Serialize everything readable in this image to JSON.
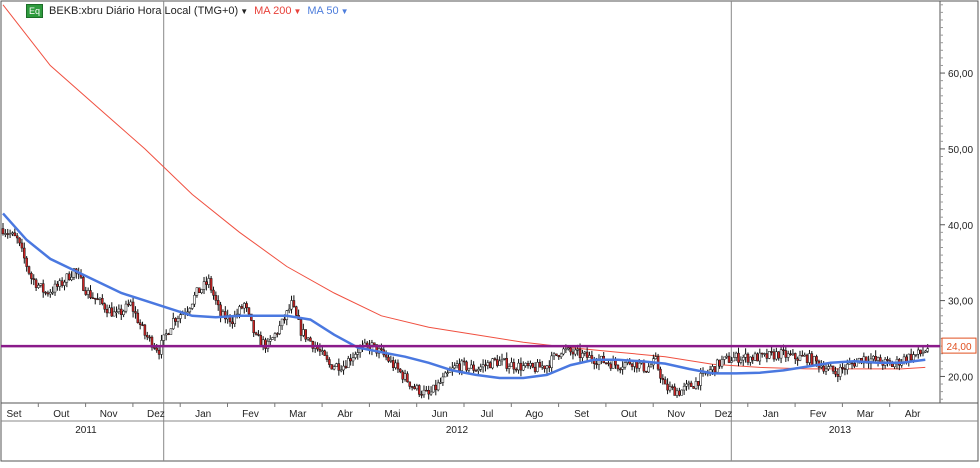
{
  "legend": {
    "badge": "Eq",
    "symbol": "BEKB:xbru Diário Hora Local (TMG+0)",
    "ma200": "MA 200",
    "ma50": "MA 50",
    "caret": "▼"
  },
  "colors": {
    "price": "#111111",
    "down_candle": "#cc2222",
    "ma200": "#f05040",
    "ma50": "#4a78e0",
    "hline": "#8a1a8a",
    "last_price": "#e05020"
  },
  "last_price_label": "24,00",
  "chart_data": {
    "type": "candlestick",
    "y_axis": {
      "ticks": [
        20,
        30,
        40,
        50,
        60
      ],
      "tick_labels": [
        "20,00",
        "30,00",
        "40,00",
        "50,00",
        "60,00"
      ],
      "range": [
        16.5,
        69.5
      ]
    },
    "x_axis": {
      "months": [
        "Set",
        "Out",
        "Nov",
        "Dez",
        "Jan",
        "Fev",
        "Mar",
        "Abr",
        "Mai",
        "Jun",
        "Jul",
        "Ago",
        "Set",
        "Out",
        "Nov",
        "Dez",
        "Jan",
        "Fev",
        "Mar",
        "Abr"
      ],
      "years": [
        "2011",
        "2012",
        "2013"
      ]
    },
    "horizontal_line": 24.0,
    "price_path": [
      [
        0,
        39.5
      ],
      [
        0.3,
        38
      ],
      [
        0.6,
        33
      ],
      [
        0.9,
        31
      ],
      [
        1.2,
        32
      ],
      [
        1.5,
        34
      ],
      [
        1.8,
        31
      ],
      [
        2.1,
        29.5
      ],
      [
        2.4,
        28
      ],
      [
        2.7,
        29.5
      ],
      [
        3.0,
        25.5
      ],
      [
        3.3,
        23.5
      ],
      [
        3.6,
        27.5
      ],
      [
        3.9,
        29
      ],
      [
        4.1,
        31
      ],
      [
        4.35,
        32.5
      ],
      [
        4.6,
        28
      ],
      [
        4.85,
        27.5
      ],
      [
        5.1,
        29.5
      ],
      [
        5.35,
        25
      ],
      [
        5.6,
        24
      ],
      [
        5.9,
        27
      ],
      [
        6.1,
        29.5
      ],
      [
        6.3,
        26
      ],
      [
        6.6,
        24
      ],
      [
        6.9,
        21.5
      ],
      [
        7.2,
        21.5
      ],
      [
        7.5,
        23.5
      ],
      [
        7.8,
        24
      ],
      [
        8.1,
        22.5
      ],
      [
        8.4,
        20.5
      ],
      [
        8.7,
        18.5
      ],
      [
        9.0,
        17.5
      ],
      [
        9.3,
        19.5
      ],
      [
        9.6,
        21.5
      ],
      [
        10.0,
        21
      ],
      [
        10.4,
        22
      ],
      [
        10.8,
        21.5
      ],
      [
        11.2,
        21
      ],
      [
        11.5,
        21.5
      ],
      [
        11.8,
        23.5
      ],
      [
        12.1,
        23
      ],
      [
        12.4,
        22.5
      ],
      [
        12.7,
        22
      ],
      [
        13.0,
        21.5
      ],
      [
        13.3,
        22
      ],
      [
        13.6,
        21
      ],
      [
        13.8,
        22
      ],
      [
        14.0,
        18.5
      ],
      [
        14.3,
        18
      ],
      [
        14.6,
        19
      ],
      [
        14.9,
        20.5
      ],
      [
        15.2,
        22
      ],
      [
        15.5,
        22.5
      ],
      [
        15.8,
        22.5
      ],
      [
        16.1,
        22.5
      ],
      [
        16.4,
        23
      ],
      [
        16.7,
        22.5
      ],
      [
        17.0,
        22.5
      ],
      [
        17.3,
        21.5
      ],
      [
        17.6,
        20.5
      ],
      [
        17.9,
        21.5
      ],
      [
        18.2,
        22.5
      ],
      [
        18.5,
        22
      ],
      [
        18.8,
        21.5
      ],
      [
        19.1,
        22.5
      ],
      [
        19.4,
        23
      ],
      [
        19.6,
        24
      ]
    ],
    "ma50": [
      [
        0,
        41.5
      ],
      [
        0.5,
        38
      ],
      [
        1.0,
        35.5
      ],
      [
        1.5,
        34
      ],
      [
        2.0,
        32.5
      ],
      [
        2.5,
        31
      ],
      [
        3.0,
        30
      ],
      [
        3.5,
        29
      ],
      [
        4.0,
        28
      ],
      [
        4.5,
        27.8
      ],
      [
        5.0,
        28
      ],
      [
        5.5,
        28
      ],
      [
        6.0,
        28
      ],
      [
        6.5,
        27.5
      ],
      [
        7.0,
        25.5
      ],
      [
        7.5,
        23.8
      ],
      [
        8.0,
        23.2
      ],
      [
        8.5,
        22.6
      ],
      [
        9.0,
        21.8
      ],
      [
        9.5,
        20.8
      ],
      [
        10.0,
        20.2
      ],
      [
        10.5,
        19.8
      ],
      [
        11.0,
        19.8
      ],
      [
        11.5,
        20.2
      ],
      [
        12.0,
        21.5
      ],
      [
        12.5,
        22.2
      ],
      [
        13.0,
        22.2
      ],
      [
        13.5,
        22
      ],
      [
        14.0,
        21.7
      ],
      [
        14.5,
        21
      ],
      [
        15.0,
        20.4
      ],
      [
        15.5,
        20.4
      ],
      [
        16.0,
        20.5
      ],
      [
        16.5,
        20.8
      ],
      [
        17.0,
        21.3
      ],
      [
        17.5,
        21.8
      ],
      [
        18.0,
        22
      ],
      [
        18.5,
        21.8
      ],
      [
        19.0,
        21.8
      ],
      [
        19.5,
        22.2
      ]
    ],
    "ma200": [
      [
        0,
        69
      ],
      [
        1.0,
        61
      ],
      [
        2.0,
        55.5
      ],
      [
        3.0,
        50
      ],
      [
        4.0,
        44
      ],
      [
        5.0,
        39
      ],
      [
        6.0,
        34.5
      ],
      [
        7.0,
        31
      ],
      [
        8.0,
        28
      ],
      [
        9.0,
        26.5
      ],
      [
        10.0,
        25.5
      ],
      [
        11.0,
        24.5
      ],
      [
        12.0,
        23.8
      ],
      [
        13.0,
        23.2
      ],
      [
        14.0,
        22.6
      ],
      [
        15.0,
        21.6
      ],
      [
        16.0,
        21.2
      ],
      [
        17.0,
        21
      ],
      [
        18.0,
        21
      ],
      [
        19.0,
        21
      ],
      [
        19.5,
        21.2
      ]
    ]
  }
}
